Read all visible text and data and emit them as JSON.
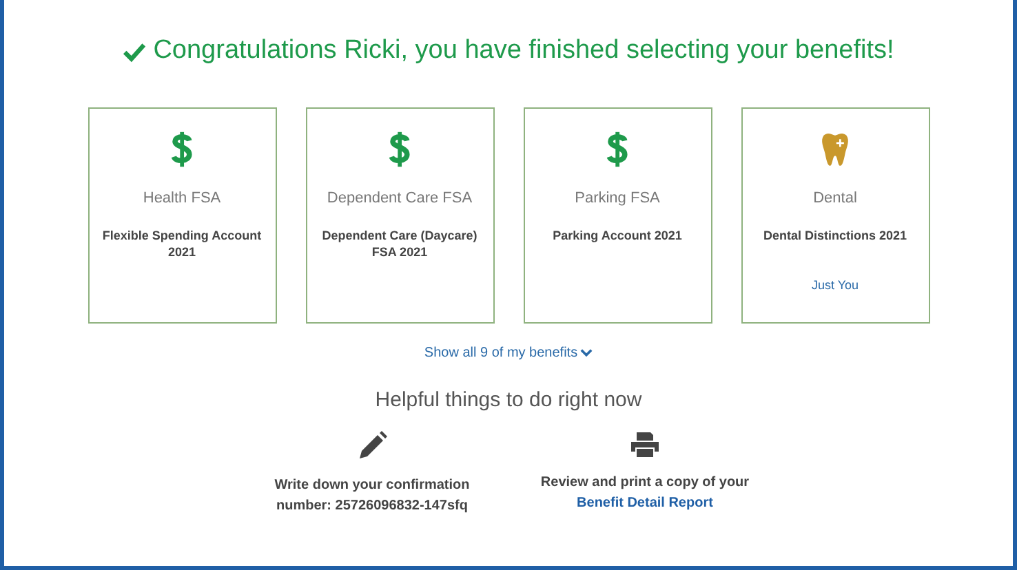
{
  "headline": "Congratulations Ricki, you have finished selecting your benefits!",
  "cards": [
    {
      "kind": "money",
      "category": "Health FSA",
      "plan": "Flexible Spending Account 2021"
    },
    {
      "kind": "money",
      "category": "Dependent Care FSA",
      "plan": "Dependent Care (Daycare) FSA 2021"
    },
    {
      "kind": "money",
      "category": "Parking FSA",
      "plan": "Parking Account 2021"
    },
    {
      "kind": "tooth",
      "category": "Dental",
      "plan": "Dental Distinctions 2021",
      "coverage": "Just You"
    }
  ],
  "show_all": "Show all 9 of my benefits",
  "helpful_title": "Helpful things to do right now",
  "actions": [
    {
      "kind": "pencil",
      "text": "Write down your confirmation number: 25726096832-147sfq"
    },
    {
      "kind": "printer",
      "text": "Review and print a copy of your",
      "link": "Benefit Detail Report"
    }
  ]
}
